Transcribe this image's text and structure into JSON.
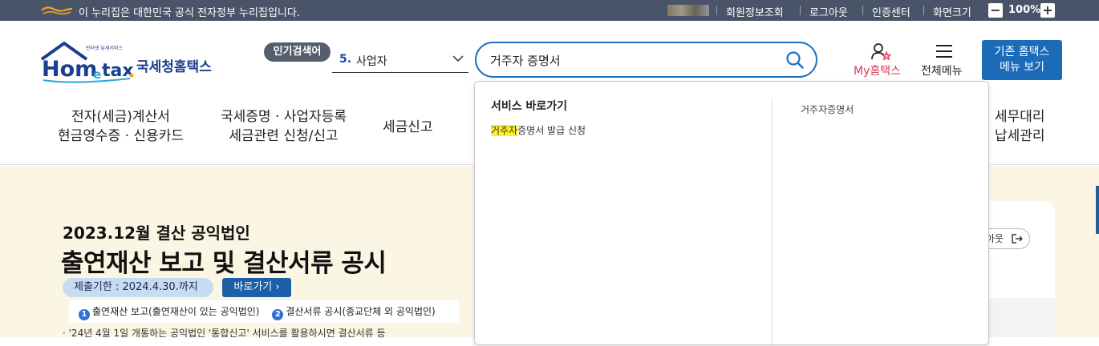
{
  "govbar": {
    "notice": "이 누리집은 대한민국 공식 전자정부 누리집입니다.",
    "links": [
      "회원정보조회",
      "로그아웃",
      "인증센터",
      "화면크기"
    ],
    "zoom_minus": "−",
    "zoom_value": "100%",
    "zoom_plus": "+"
  },
  "header": {
    "brand": "국세청홈택스",
    "tagline": "인터넷 납세서비스",
    "popular_label": "인기검색어",
    "popular_rank": "5.",
    "popular_keyword": "사업자",
    "search_value": "거주자 증명서",
    "my_label": "My홈택스",
    "all_menu_label": "전체메뉴",
    "old_home_line1": "기존 홈택스",
    "old_home_line2": "메뉴 보기"
  },
  "nav": [
    {
      "line1": "전자(세금)계산서",
      "line2": "현금영수증 · 신용카드"
    },
    {
      "line1": "국세증명 · 사업자등록",
      "line2": "세금관련 신청/신고"
    },
    {
      "line1": "세금신고",
      "line2": ""
    },
    {
      "line1": "세무대리",
      "line2": "납세관리"
    }
  ],
  "hero": {
    "subtitle": "2023.12월 결산 공익법인",
    "title": "출연재산 보고 및 결산서류 공시",
    "deadline": "제출기한 : 2024.4.30.까지",
    "go_button": "바로가기 ›",
    "item1_no": "1",
    "item1": "출연재산 보고(출연재산이 있는 공익법인)",
    "item2_no": "2",
    "item2": "결산서류 공시(종교단체 외 공익법인)",
    "note": "· '24년 4월 1일 개통하는 공익법인 '통합신고' 서비스를 활용하시면 결산서류 등",
    "logout_label": "아웃"
  },
  "autocomplete": {
    "section_title": "서비스 바로가기",
    "result_highlight": "거주자",
    "result_rest": "증명서 발급 신청",
    "recent_item": "거주자증명서"
  },
  "colors": {
    "govbar_bg": "#4a5468",
    "search_border": "#1f6fc2",
    "highlight": "#ffef2a",
    "hero_bg": "#fbf6e4",
    "brand_blue": "#1b3f8f"
  }
}
